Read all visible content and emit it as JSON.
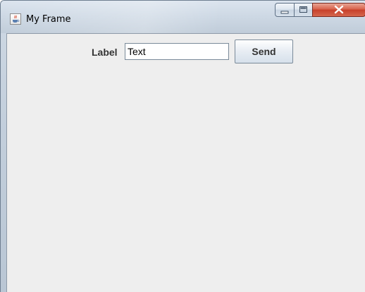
{
  "window": {
    "title": "My Frame",
    "icon": "java-cup-icon",
    "controls": [
      "minimize-icon",
      "maximize-icon",
      "close-icon"
    ]
  },
  "form": {
    "label": "Label",
    "text_field_value": "Text",
    "send_label": "Send"
  }
}
